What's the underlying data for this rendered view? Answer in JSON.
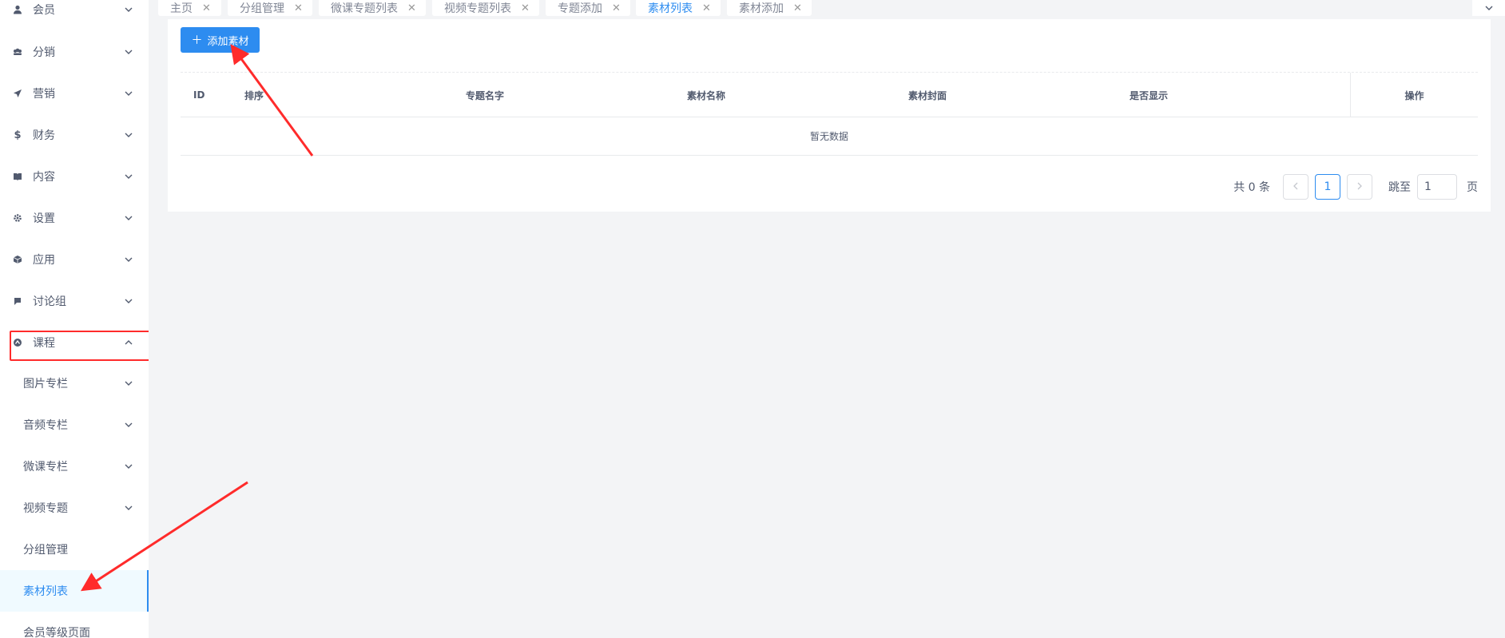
{
  "sidebar": {
    "menu": [
      {
        "label": "会员",
        "icon": "user-icon",
        "expanded": false
      },
      {
        "label": "分销",
        "icon": "group-icon",
        "expanded": false
      },
      {
        "label": "营销",
        "icon": "send-icon",
        "expanded": false
      },
      {
        "label": "财务",
        "icon": "dollar-icon",
        "expanded": false
      },
      {
        "label": "内容",
        "icon": "book-icon",
        "expanded": false
      },
      {
        "label": "设置",
        "icon": "gear-icon",
        "expanded": false
      },
      {
        "label": "应用",
        "icon": "cube-icon",
        "expanded": false
      },
      {
        "label": "讨论组",
        "icon": "chat-icon",
        "expanded": false
      },
      {
        "label": "课程",
        "icon": "course-icon",
        "expanded": true
      }
    ],
    "sub_items": [
      {
        "label": "图片专栏",
        "has_children": true
      },
      {
        "label": "音频专栏",
        "has_children": true
      },
      {
        "label": "微课专栏",
        "has_children": true
      },
      {
        "label": "视频专题",
        "has_children": true
      },
      {
        "label": "分组管理",
        "has_children": false
      },
      {
        "label": "素材列表",
        "has_children": false,
        "active": true
      },
      {
        "label": "会员等级页面",
        "has_children": false
      }
    ]
  },
  "tabs": [
    {
      "label": "主页"
    },
    {
      "label": "分组管理"
    },
    {
      "label": "微课专题列表"
    },
    {
      "label": "视频专题列表"
    },
    {
      "label": "专题添加"
    },
    {
      "label": "素材列表",
      "active": true
    },
    {
      "label": "素材添加"
    }
  ],
  "toolbar": {
    "add_label": "添加素材",
    "add_icon": "plus-icon"
  },
  "table": {
    "columns": [
      "ID",
      "排序",
      "专题名字",
      "素材名称",
      "素材封面",
      "是否显示",
      "操作"
    ],
    "rows": [],
    "empty_text": "暂无数据"
  },
  "pagination": {
    "total_text": "共 0 条",
    "current_page": "1",
    "jump_label": "跳至",
    "jump_value": "1",
    "page_suffix": "页"
  },
  "colors": {
    "primary": "#2d8cf0",
    "annotation": "#ff2b2b"
  }
}
